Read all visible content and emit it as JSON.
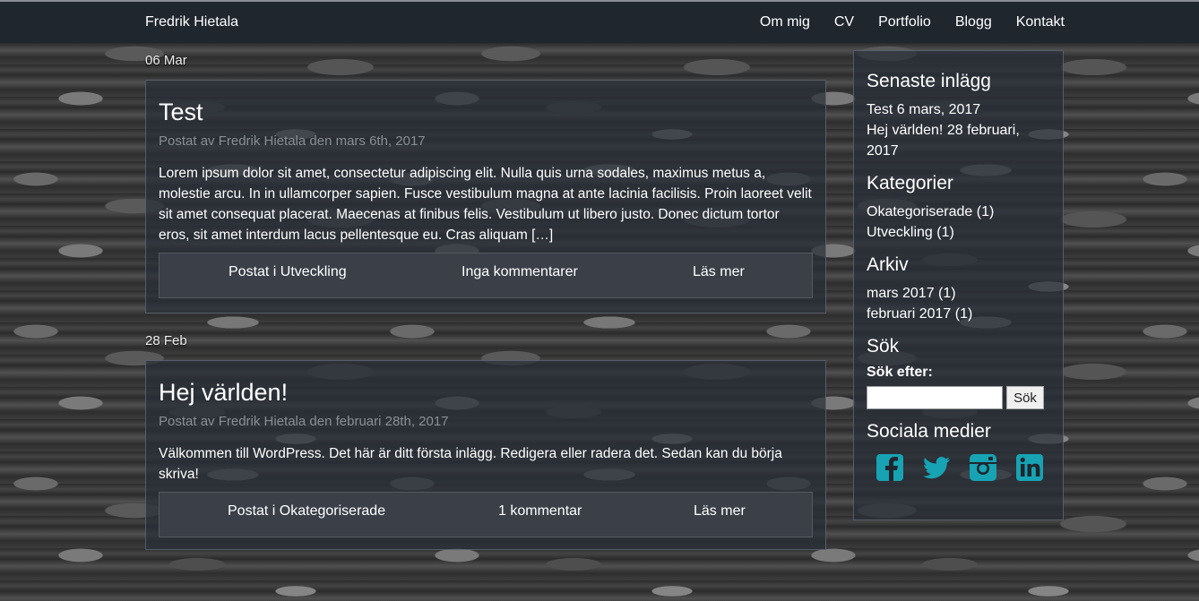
{
  "header": {
    "brand": "Fredrik Hietala",
    "nav": [
      "Om mig",
      "CV",
      "Portfolio",
      "Blogg",
      "Kontakt"
    ]
  },
  "posts": [
    {
      "date": "06 Mar",
      "title": "Test",
      "meta": "Postat av Fredrik Hietala den mars 6th, 2017",
      "excerpt": "Lorem ipsum dolor sit amet, consectetur adipiscing elit. Nulla quis urna sodales, maximus metus a, molestie arcu. In in ullamcorper sapien. Fusce vestibulum magna at ante lacinia facilisis. Proin laoreet velit sit amet consequat placerat. Maecenas at finibus felis. Vestibulum ut libero justo. Donec dictum tortor eros, sit amet interdum lacus pellentesque eu. Cras aliquam […]",
      "category": "Postat i Utveckling",
      "comments": "Inga kommentarer",
      "readmore": "Läs mer"
    },
    {
      "date": "28 Feb",
      "title": "Hej världen!",
      "meta": "Postat av Fredrik Hietala den februari 28th, 2017",
      "excerpt": "Välkommen till WordPress. Det här är ditt första inlägg. Redigera eller radera det. Sedan kan du börja skriva!",
      "category": "Postat i Okategoriserade",
      "comments": "1 kommentar",
      "readmore": "Läs mer"
    }
  ],
  "sidebar": {
    "recent_title": "Senaste inlägg",
    "recent": [
      "Test 6 mars, 2017",
      "Hej världen! 28 februari, 2017"
    ],
    "categories_title": "Kategorier",
    "categories": [
      "Okategoriserade (1)",
      "Utveckling (1)"
    ],
    "archive_title": "Arkiv",
    "archive": [
      "mars 2017 (1)",
      "februari 2017 (1)"
    ],
    "search_title": "Sök",
    "search_label": "Sök efter:",
    "search_value": "",
    "search_button": "Sök",
    "social_title": "Sociala medier",
    "social_icons": [
      "facebook-icon",
      "twitter-icon",
      "instagram-icon",
      "linkedin-icon"
    ]
  },
  "colors": {
    "social": "#17a3b3",
    "topbar": "#1f262e",
    "meta": "#8a8f96"
  }
}
